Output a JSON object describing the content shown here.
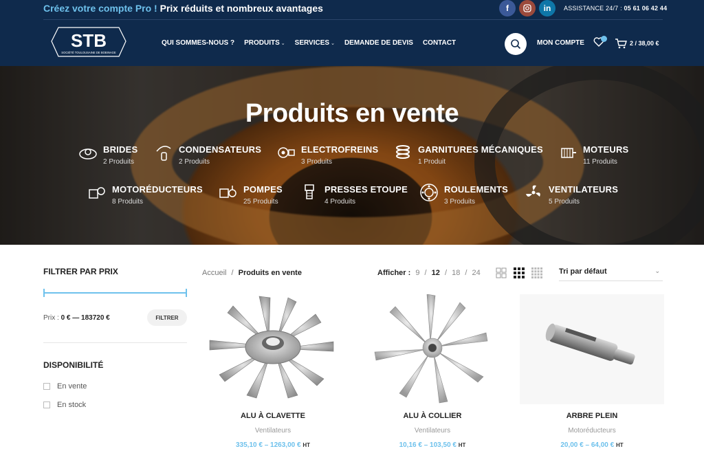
{
  "topbar": {
    "promo_accent": "Créez votre compte Pro !",
    "promo_text": "Prix réduits et nombreux avantages",
    "assist_label": "ASSISTANCE 24/7 :",
    "assist_phone": "05 61 06 42 44",
    "social": [
      {
        "icon": "facebook-icon",
        "glyph": "f",
        "color": "#3b5998"
      },
      {
        "icon": "instagram-icon",
        "glyph": "◎",
        "color": "#9b4a3c"
      },
      {
        "icon": "linkedin-icon",
        "glyph": "in",
        "color": "#0e76a8"
      }
    ]
  },
  "header": {
    "logo_text": "STB",
    "logo_sub": "SOCIÉTÉ TOULOUSAINE DE BOBINAGE",
    "nav": [
      {
        "label": "QUI SOMMES-NOUS ?",
        "dropdown": false
      },
      {
        "label": "PRODUITS",
        "dropdown": true
      },
      {
        "label": "SERVICES",
        "dropdown": true
      },
      {
        "label": "DEMANDE DE DEVIS",
        "dropdown": false
      },
      {
        "label": "CONTACT",
        "dropdown": false
      }
    ],
    "account_label": "MON COMPTE",
    "cart_text": "2 / 38,00 €"
  },
  "hero": {
    "title": "Produits en vente",
    "categories": [
      {
        "name": "BRIDES",
        "count": "2 Produits",
        "icon": "flange-icon"
      },
      {
        "name": "CONDENSATEURS",
        "count": "2 Produits",
        "icon": "capacitor-icon"
      },
      {
        "name": "ELECTROFREINS",
        "count": "3 Produits",
        "icon": "electrobrake-icon"
      },
      {
        "name": "GARNITURES MÉCANIQUES",
        "count": "1 Produit",
        "icon": "mechanical-seal-icon"
      },
      {
        "name": "MOTEURS",
        "count": "11 Produits",
        "icon": "motor-icon"
      },
      {
        "name": "MOTORÉDUCTEURS",
        "count": "8 Produits",
        "icon": "gearmotor-icon"
      },
      {
        "name": "POMPES",
        "count": "25 Produits",
        "icon": "pump-icon"
      },
      {
        "name": "PRESSES ETOUPE",
        "count": "4 Produits",
        "icon": "cable-gland-icon"
      },
      {
        "name": "ROULEMENTS",
        "count": "3 Produits",
        "icon": "bearing-icon"
      },
      {
        "name": "VENTILATEURS",
        "count": "5 Produits",
        "icon": "fan-icon"
      }
    ]
  },
  "sidebar": {
    "price_title": "FILTRER PAR PRIX",
    "price_label": "Prix :",
    "price_min": "0 €",
    "price_sep": "—",
    "price_max": "183720 €",
    "filter_btn": "FILTRER",
    "avail_title": "DISPONIBILITÉ",
    "avail_options": [
      "En vente",
      "En stock"
    ]
  },
  "toolbar": {
    "breadcrumb_home": "Accueil",
    "breadcrumb_sep": "/",
    "breadcrumb_current": "Produits en vente",
    "show_label": "Afficher :",
    "show_options": [
      "9",
      "12",
      "18",
      "24"
    ],
    "show_current": "12",
    "sort_label": "Tri par défaut"
  },
  "products": [
    {
      "name": "ALU À CLAVETTE",
      "category": "Ventilateurs",
      "price": "335,10 € – 1263,00 €",
      "ht": "HT"
    },
    {
      "name": "ALU À COLLIER",
      "category": "Ventilateurs",
      "price": "10,16 € – 103,50 €",
      "ht": "HT"
    },
    {
      "name": "ARBRE PLEIN",
      "category": "Motoréducteurs",
      "price": "20,00 € – 64,00 €",
      "ht": "HT"
    }
  ],
  "colors": {
    "navy": "#0f2a4c",
    "accent": "#6ec1ec"
  }
}
